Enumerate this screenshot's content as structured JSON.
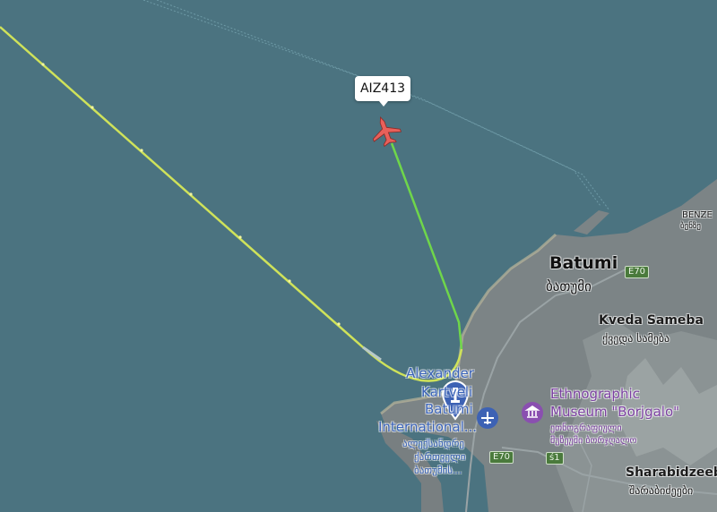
{
  "flight": {
    "callsign": "AIZ413",
    "track_color_ascent": "#6fd64a",
    "track_color_cruise": "#cfe25a",
    "aircraft_color": "#e8605a"
  },
  "city": {
    "name": "Batumi",
    "name_ka": "ბათუმი"
  },
  "districts": {
    "kveda_sameba": {
      "name": "Kveda Sameba",
      "name_ka": "ქვედა სამება"
    },
    "sharabidzeebi": {
      "name": "Sharabidzeeb",
      "name_ka": "შარაბიძეები"
    },
    "benze": {
      "name": "BENZE",
      "name_ka": "ბენზე"
    }
  },
  "airport": {
    "name_line1": "Alexander",
    "name_line2": "Kartveli",
    "name_line3": "Batumi",
    "name_line4": "International...",
    "name_ka_line1": "ალექსანდრე",
    "name_ka_line2": "ქართველი",
    "name_ka_line3": "ბათუმის..."
  },
  "museum": {
    "name_line1": "Ethnographic",
    "name_line2": "Museum \"Borjgalo\"",
    "name_ka_line1": "ეთნოგრაფიული",
    "name_ka_line2": "მუზეუმი ბორჯღალო"
  },
  "roads": {
    "e70_north": "E70",
    "e70_south": "E70",
    "r1": "ś1"
  },
  "colors": {
    "sea": "#4b7380",
    "land": "#7c8486",
    "mountain": "#8e9597",
    "shore": "#b9b59a"
  }
}
